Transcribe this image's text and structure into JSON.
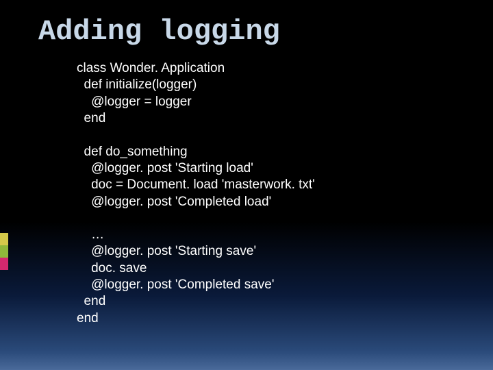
{
  "slide": {
    "title": "Adding logging",
    "code": "class Wonder. Application\n  def initialize(logger)\n    @logger = logger\n  end\n\n  def do_something\n    @logger. post 'Starting load'\n    doc = Document. load 'masterwork. txt'\n    @logger. post 'Completed load'\n\n    …\n    @logger. post 'Starting save'\n    doc. save\n    @logger. post 'Completed save'\n  end\nend"
  }
}
